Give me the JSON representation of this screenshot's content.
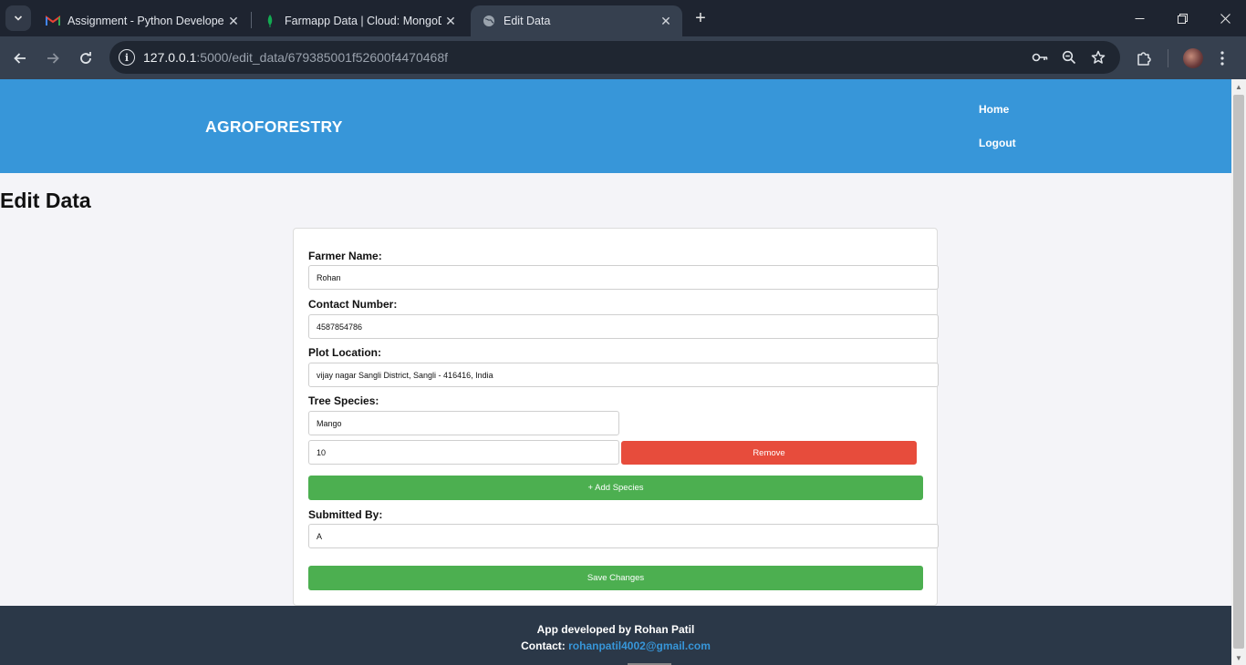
{
  "browser": {
    "tabs": [
      {
        "title": "Assignment - Python Developer",
        "icon": "gmail-icon",
        "active": false
      },
      {
        "title": "Farmapp Data | Cloud: MongoDB",
        "icon": "mongodb-leaf-icon",
        "active": false
      },
      {
        "title": "Edit Data",
        "icon": "globe-icon",
        "active": true
      }
    ],
    "url_host": "127.0.0.1",
    "url_path": ":5000/edit_data/679385001f52600f4470468f"
  },
  "header": {
    "brand": "AGROFORESTRY",
    "nav": [
      "Home",
      "Logout"
    ],
    "color": "#3796d9"
  },
  "page": {
    "title": "Edit Data"
  },
  "form": {
    "farmer_name_label": "Farmer Name:",
    "farmer_name_value": "Rohan",
    "contact_label": "Contact Number:",
    "contact_value": "4587854786",
    "location_label": "Plot Location:",
    "location_value": "vijay nagar Sangli District, Sangli - 416416, India",
    "species_label": "Tree Species:",
    "species": [
      {
        "name": "Mango",
        "count": "10"
      }
    ],
    "remove_label": "Remove",
    "add_species_label": "+ Add Species",
    "submitted_by_label": "Submitted By:",
    "submitted_by_value": "A",
    "save_label": "Save Changes",
    "colors": {
      "remove": "#e74c3c",
      "primary": "#4caf50"
    }
  },
  "footer": {
    "developed_prefix": "App developed by ",
    "developer": "Rohan Patil",
    "contact_prefix": "Contact: ",
    "email": "rohanpatil4002@gmail.com"
  }
}
